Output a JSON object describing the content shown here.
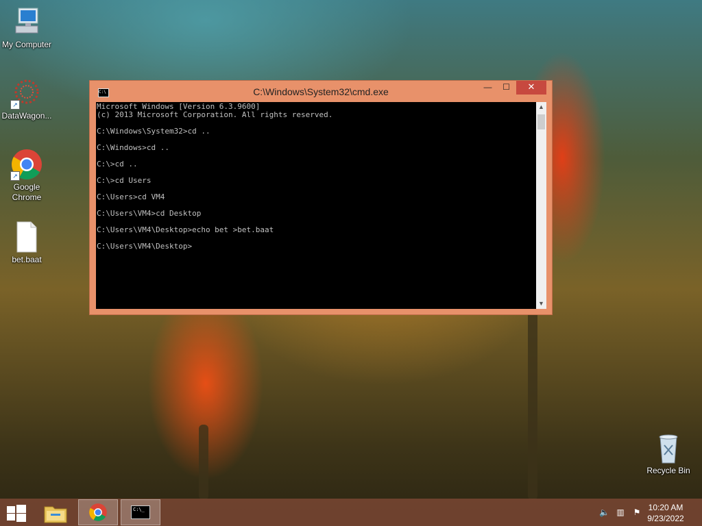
{
  "desktop": {
    "icons": [
      {
        "label": "My Computer",
        "icon": "computer-icon"
      },
      {
        "label": "DataWagon...",
        "icon": "datawagon-icon"
      },
      {
        "label": "Google Chrome",
        "icon": "chrome-icon"
      },
      {
        "label": "bet.baat",
        "icon": "file-icon"
      },
      {
        "label": "Recycle Bin",
        "icon": "recycle-bin-icon"
      }
    ]
  },
  "window": {
    "title": "C:\\Windows\\System32\\cmd.exe",
    "icon_text": "C:\\",
    "buttons": {
      "minimize": "—",
      "maximize": "☐",
      "close": "✕"
    },
    "console_text": "Microsoft Windows [Version 6.3.9600]\n(c) 2013 Microsoft Corporation. All rights reserved.\n\nC:\\Windows\\System32>cd ..\n\nC:\\Windows>cd ..\n\nC:\\>cd ..\n\nC:\\>cd Users\n\nC:\\Users>cd VM4\n\nC:\\Users\\VM4>cd Desktop\n\nC:\\Users\\VM4\\Desktop>echo bet >bet.baat\n\nC:\\Users\\VM4\\Desktop>"
  },
  "taskbar": {
    "items": [
      "start-button",
      "file-explorer",
      "google-chrome",
      "command-prompt"
    ],
    "cmd_icon_text": "C:\\_",
    "tray": [
      "volume-muted-icon",
      "network-icon",
      "action-center-icon"
    ],
    "time": "10:20 AM",
    "date": "9/23/2022"
  },
  "colors": {
    "window_frame": "#e8916a",
    "close_button": "#c7493f",
    "console_bg": "#000000",
    "console_text": "#c0c0c0"
  }
}
